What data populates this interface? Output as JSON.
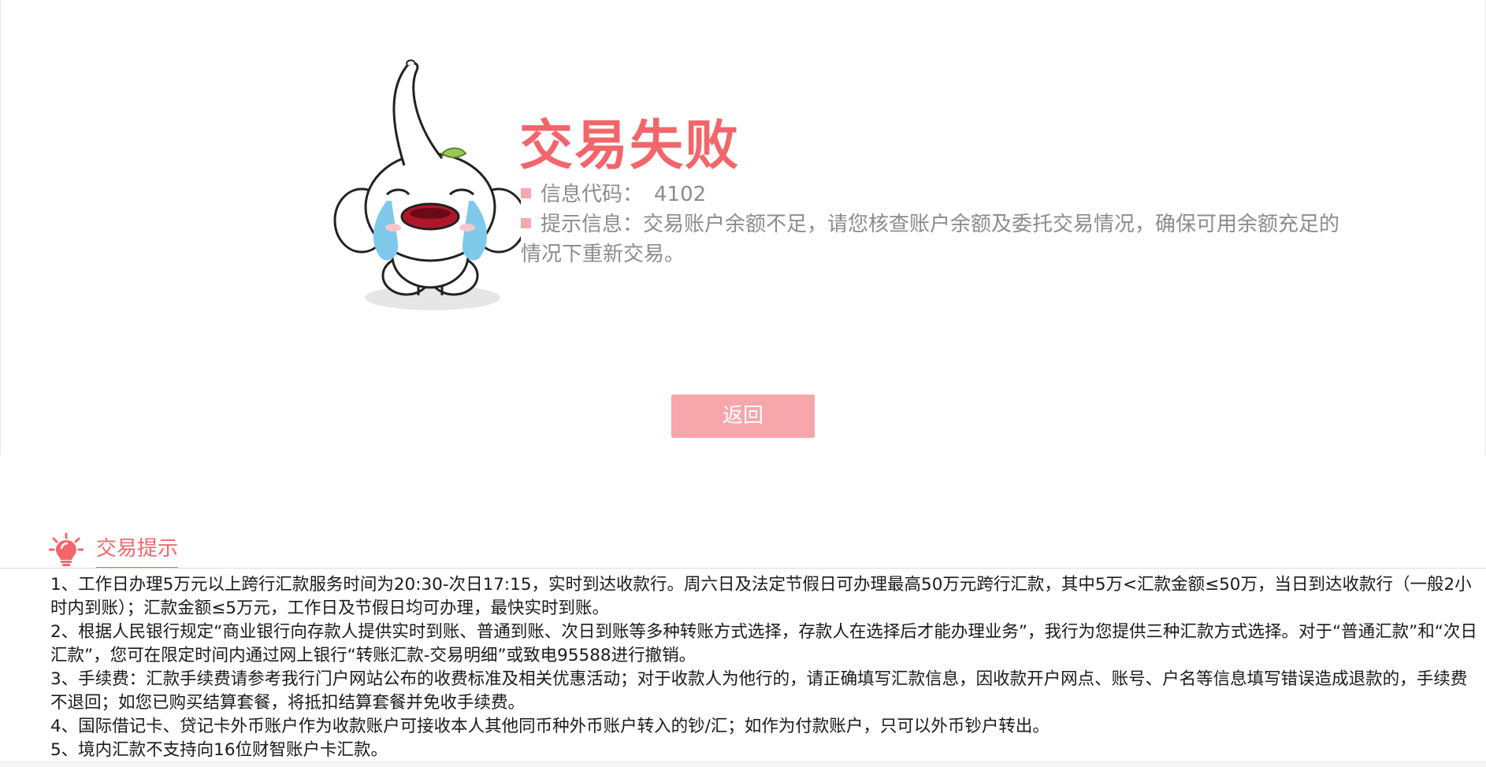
{
  "result": {
    "title": "交易失败",
    "code_label": "信息代码：",
    "code_value": "4102",
    "message_label": "提示信息：",
    "message_text": "交易账户余额不足，请您核查账户余额及委托交易情况，确保可用余额充足的情况下重新交易。"
  },
  "actions": {
    "back_label": "返回"
  },
  "tips": {
    "title": "交易提示",
    "items": [
      "1、工作日办理5万元以上跨行汇款服务时间为20:30-次日17:15，实时到达收款行。周六日及法定节假日可办理最高50万元跨行汇款，其中5万<汇款金额≤50万，当日到达收款行（一般2小时内到账）；汇款金额≤5万元，工作日及节假日均可办理，最快实时到账。",
      "2、根据人民银行规定“商业银行向存款人提供实时到账、普通到账、次日到账等多种转账方式选择，存款人在选择后才能办理业务”，我行为您提供三种汇款方式选择。对于“普通汇款”和“次日汇款”，您可在限定时间内通过网上银行“转账汇款-交易明细”或致电95588进行撤销。",
      "3、手续费：汇款手续费请参考我行门户网站公布的收费标准及相关优惠活动；对于收款人为他行的，请正确填写汇款信息，因收款开户网点、账号、户名等信息填写错误造成退款的，手续费不退回；如您已购买结算套餐，将抵扣结算套餐并免收手续费。",
      "4、国际借记卡、贷记卡外币账户作为收款账户可接收本人其他同币种外币账户转入的钞/汇；如作为付款账户，只可以外币钞户转出。",
      "5、境内汇款不支持向16位财智账户卡汇款。"
    ]
  },
  "colors": {
    "accent": "#f2666b",
    "button": "#f7a6ac",
    "bullet": "#f2aab0",
    "muted_text": "#8c8c8c"
  },
  "icons": {
    "mascot": "crying-mascot-illustration",
    "tips": "lightbulb-icon",
    "bullet": "square-bullet"
  }
}
